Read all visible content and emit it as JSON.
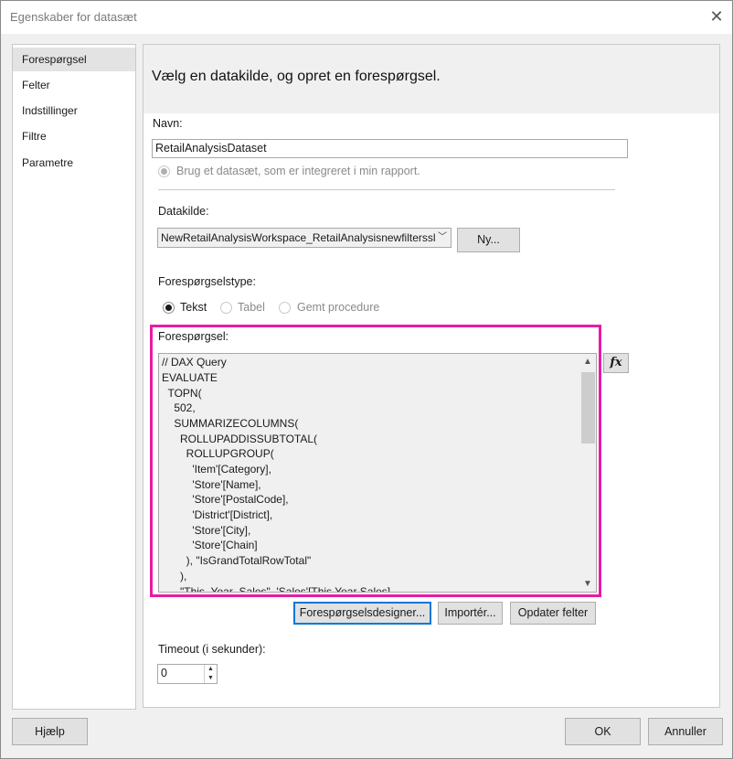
{
  "window": {
    "title": "Egenskaber for datasæt",
    "close_icon": "close-icon"
  },
  "nav": {
    "items": [
      {
        "label": "Forespørgsel",
        "selected": true
      },
      {
        "label": "Felter",
        "selected": false
      },
      {
        "label": "Indstillinger",
        "selected": false
      },
      {
        "label": "Filtre",
        "selected": false
      },
      {
        "label": "Parametre",
        "selected": false
      }
    ]
  },
  "main": {
    "heading": "Vælg en datakilde, og opret en forespørgsel.",
    "name_label": "Navn:",
    "name_value": "RetailAnalysisDataset",
    "embedded_option": "Brug et datasæt, som er integreret i min rapport.",
    "datasource_label": "Datakilde:",
    "datasource_value": "NewRetailAnalysisWorkspace_RetailAnalysisnewfilterssl",
    "new_button": "Ny...",
    "query_type_label": "Forespørgselstype:",
    "query_types": [
      {
        "label": "Tekst",
        "selected": true
      },
      {
        "label": "Tabel",
        "selected": false
      },
      {
        "label": "Gemt procedure",
        "selected": false
      }
    ],
    "query_label": "Forespørgsel:",
    "query_lines": [
      "// DAX Query",
      "EVALUATE",
      "  TOPN(",
      "    502,",
      "    SUMMARIZECOLUMNS(",
      "      ROLLUPADDISSUBTOTAL(",
      "        ROLLUPGROUP(",
      "          'Item'[Category],",
      "          'Store'[Name],",
      "          'Store'[PostalCode],",
      "          'District'[District],",
      "          'Store'[City],",
      "          'Store'[Chain]",
      "        ), \"IsGrandTotalRowTotal\"",
      "      ),",
      "      \"This_Year_Sales\", 'Sales'[This Year Sales]"
    ],
    "fx_label": "fx",
    "designer_button": "Forespørgselsdesigner...",
    "import_button": "Importér...",
    "refresh_button": "Opdater felter",
    "timeout_label": "Timeout (i sekunder):",
    "timeout_value": "0"
  },
  "footer": {
    "help_button": "Hjælp",
    "ok_button": "OK",
    "cancel_button": "Annuller"
  },
  "colors": {
    "highlight": "#e81ba4",
    "accent": "#0078d7"
  }
}
